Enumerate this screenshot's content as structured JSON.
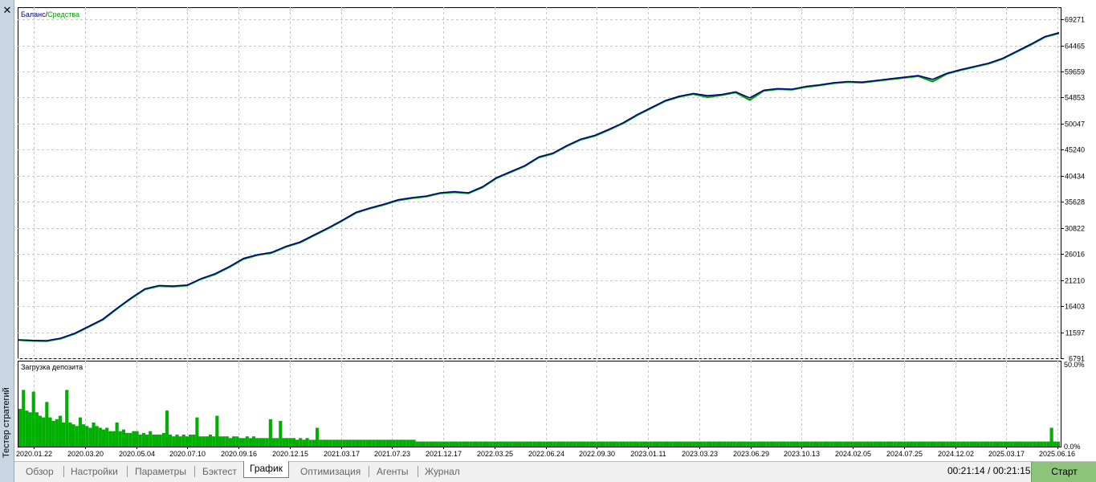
{
  "panel": {
    "title": "Тестер стратегий",
    "close_label": "✕"
  },
  "chart_data": [
    {
      "type": "line",
      "title": "",
      "legend": [
        "Баланс",
        "Средства"
      ],
      "legend_separator": " / ",
      "colors": {
        "balance": "#00007f",
        "equity": "#00a000"
      },
      "ylim": [
        6791,
        71500
      ],
      "y_ticks": [
        "69271",
        "64465",
        "59659",
        "54853",
        "50047",
        "45240",
        "40434",
        "35628",
        "30822",
        "26016",
        "21210",
        "16403",
        "11597",
        "6791"
      ],
      "x_ticks": [
        "2020.01.22",
        "2020.03.20",
        "2020.05.04",
        "2020.07.10",
        "2020.09.16",
        "2020.12.15",
        "2021.03.17",
        "2021.07.23",
        "2021.12.17",
        "2022.03.25",
        "2022.06.24",
        "2022.09.30",
        "2023.01.11",
        "2023.03.23",
        "2023.06.29",
        "2023.10.13",
        "2024.02.05",
        "2024.07.25",
        "2024.12.02",
        "2025.03.17",
        "2025.06.16"
      ],
      "grid": true,
      "series": [
        {
          "name": "Баланс",
          "values": [
            10200,
            10100,
            10050,
            10500,
            11400,
            12700,
            14000,
            16000,
            17900,
            19600,
            20200,
            20100,
            20300,
            21500,
            22400,
            23700,
            25200,
            25900,
            26300,
            27400,
            28200,
            29500,
            30800,
            32200,
            33700,
            34500,
            35200,
            36000,
            36400,
            36700,
            37300,
            37500,
            37300,
            38400,
            40100,
            41200,
            42300,
            43900,
            44600,
            46000,
            47200,
            47900,
            49000,
            50200,
            51700,
            53000,
            54300,
            55100,
            55600,
            55200,
            55400,
            55900,
            54800,
            56200,
            56500,
            56400,
            56900,
            57200,
            57600,
            57800,
            57700,
            58000,
            58300,
            58600,
            58900,
            58200,
            59300,
            60000,
            60600,
            61200,
            62100,
            63400,
            64700,
            66100,
            66800
          ]
        },
        {
          "name": "Средства",
          "values": [
            10150,
            10000,
            9950,
            10400,
            11300,
            12600,
            13900,
            15900,
            17800,
            19500,
            20100,
            20000,
            20200,
            21400,
            22300,
            23600,
            25100,
            25800,
            26200,
            27300,
            28100,
            29400,
            30700,
            32100,
            33600,
            34400,
            35100,
            35900,
            36300,
            36600,
            37200,
            37400,
            37200,
            38300,
            40000,
            41100,
            42200,
            43800,
            44500,
            45900,
            47100,
            47800,
            48900,
            50100,
            51600,
            52900,
            54200,
            55000,
            55500,
            54900,
            55300,
            55800,
            54400,
            56100,
            56400,
            56300,
            56800,
            57100,
            57500,
            57700,
            57600,
            57900,
            58200,
            58500,
            58800,
            57800,
            59200,
            59900,
            60500,
            61100,
            62000,
            63300,
            64600,
            66000,
            66700
          ]
        }
      ]
    },
    {
      "type": "bar",
      "title": "Загрузка депозита",
      "ylim": [
        0,
        50
      ],
      "y_ticks": [
        "50.0%",
        "0.0%"
      ],
      "color": "#00b000",
      "series": [
        {
          "name": "",
          "values": [
            22,
            33,
            21,
            20,
            32,
            20,
            18,
            17,
            26,
            17,
            15,
            16,
            18,
            14,
            33,
            14,
            13,
            12,
            17,
            13,
            12,
            11,
            14,
            12,
            11,
            10,
            11,
            9,
            9,
            14,
            9,
            10,
            8,
            8,
            9,
            9,
            7,
            8,
            7,
            9,
            7,
            7,
            7,
            8,
            21,
            7,
            6,
            7,
            6,
            7,
            6,
            7,
            7,
            17,
            6,
            6,
            6,
            7,
            6,
            18,
            6,
            6,
            6,
            5,
            6,
            6,
            5,
            5,
            6,
            5,
            6,
            5,
            5,
            5,
            5,
            16,
            5,
            5,
            15,
            5,
            5,
            5,
            5,
            4,
            5,
            4,
            5,
            4,
            4,
            11,
            4,
            4,
            4,
            4,
            4,
            4,
            4,
            4,
            4,
            4,
            4,
            4,
            4,
            4,
            4,
            4,
            4,
            4,
            4,
            4,
            4,
            4,
            4,
            4,
            4,
            4,
            4,
            4,
            4,
            3,
            3,
            3,
            3,
            3,
            3,
            3,
            3,
            3,
            3,
            3,
            3,
            3,
            3,
            3,
            3,
            3,
            3,
            3,
            3,
            3,
            3,
            3,
            3,
            3,
            3,
            3,
            3,
            3,
            3,
            3,
            3,
            3,
            3,
            3,
            3,
            3,
            3,
            3,
            3,
            3,
            3,
            3,
            3,
            3,
            3,
            3,
            3,
            3,
            3,
            3,
            3,
            3,
            3,
            3,
            3,
            3,
            3,
            3,
            3,
            3,
            3,
            3,
            3,
            3,
            3,
            3,
            3,
            3,
            3,
            3,
            3,
            3,
            3,
            3,
            3,
            3,
            3,
            3,
            3,
            3,
            3,
            3,
            3,
            3,
            3,
            3,
            3,
            3,
            3,
            3,
            3,
            3,
            3,
            3,
            3,
            3,
            3,
            3,
            3,
            3,
            3,
            3,
            3,
            3,
            3,
            3,
            3,
            3,
            3,
            3,
            3,
            3,
            3,
            3,
            3,
            3,
            3,
            3,
            3,
            3,
            3,
            3,
            3,
            3,
            3,
            3,
            3,
            3,
            3,
            3,
            3,
            3,
            3,
            3,
            3,
            3,
            3,
            3,
            3,
            3,
            3,
            3,
            3,
            3,
            3,
            3,
            3,
            3,
            3,
            3,
            3,
            3,
            3,
            3,
            3,
            3,
            3,
            3,
            3,
            3,
            3,
            3,
            3,
            3,
            3,
            3,
            3,
            3,
            3,
            3,
            3,
            3,
            3,
            3,
            3,
            3,
            3,
            3,
            3,
            3,
            3,
            3,
            3,
            3,
            3,
            3,
            3,
            3,
            3,
            11,
            3,
            3
          ]
        }
      ]
    }
  ],
  "tabs": [
    {
      "label": "Обзор",
      "active": false
    },
    {
      "label": "Настройки",
      "active": false
    },
    {
      "label": "Параметры",
      "active": false
    },
    {
      "label": "Бэктест",
      "active": false
    },
    {
      "label": "График",
      "active": true
    },
    {
      "label": "Оптимизация",
      "active": false
    },
    {
      "label": "Агенты",
      "active": false
    },
    {
      "label": "Журнал",
      "active": false
    }
  ],
  "status": {
    "timer": "00:21:14 / 00:21:15",
    "start_label": "Старт"
  }
}
